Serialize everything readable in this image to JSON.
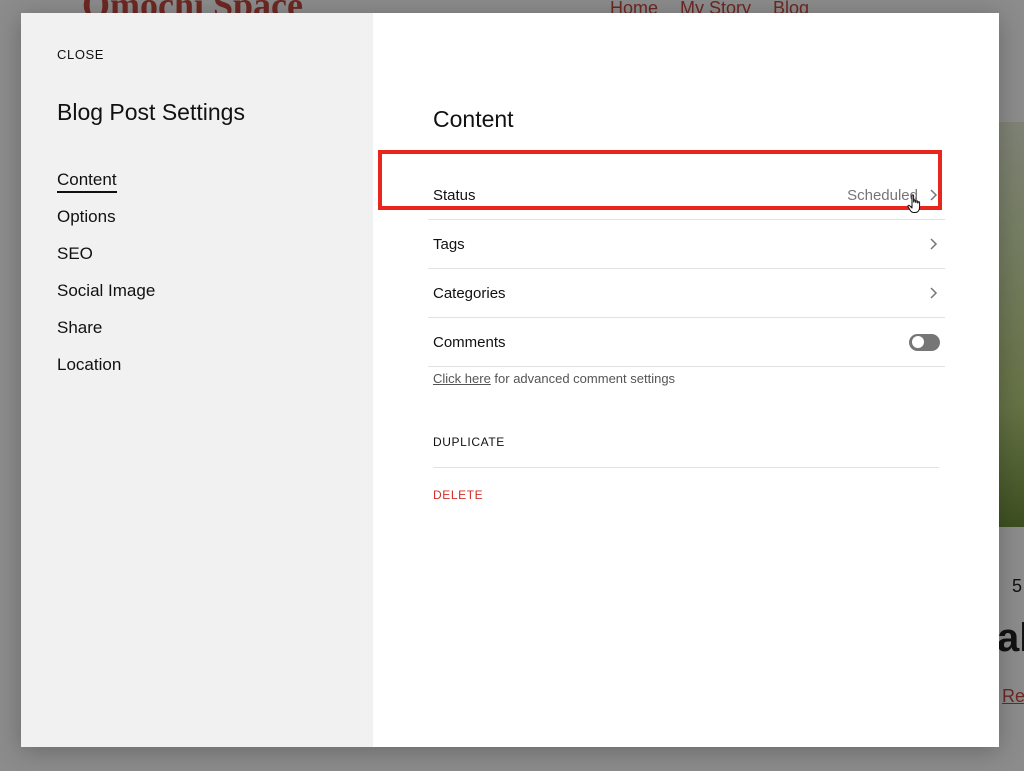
{
  "site": {
    "title": "Omochi Space",
    "nav": [
      "Home",
      "My Story",
      "Blog"
    ],
    "partial_digit": "5",
    "partial_heading": "ab",
    "partial_link": "Re"
  },
  "modal": {
    "close_label": "CLOSE",
    "title": "Blog Post Settings",
    "nav_items": [
      "Content",
      "Options",
      "SEO",
      "Social Image",
      "Share",
      "Location"
    ],
    "active_nav": "Content"
  },
  "content": {
    "title": "Content",
    "rows": {
      "status": {
        "label": "Status",
        "value": "Scheduled"
      },
      "tags": {
        "label": "Tags"
      },
      "categories": {
        "label": "Categories"
      },
      "comments": {
        "label": "Comments",
        "toggle_on": false
      }
    },
    "comment_help_link": "Click here",
    "comment_help_text": " for advanced comment settings",
    "duplicate_label": "DUPLICATE",
    "delete_label": "DELETE"
  },
  "colors": {
    "highlight": "#e8261c",
    "delete": "#d0302a",
    "brand": "#c94a3f"
  },
  "icons": {
    "chevron": "chevron-right-icon",
    "cursor": "hand-pointer-icon"
  }
}
